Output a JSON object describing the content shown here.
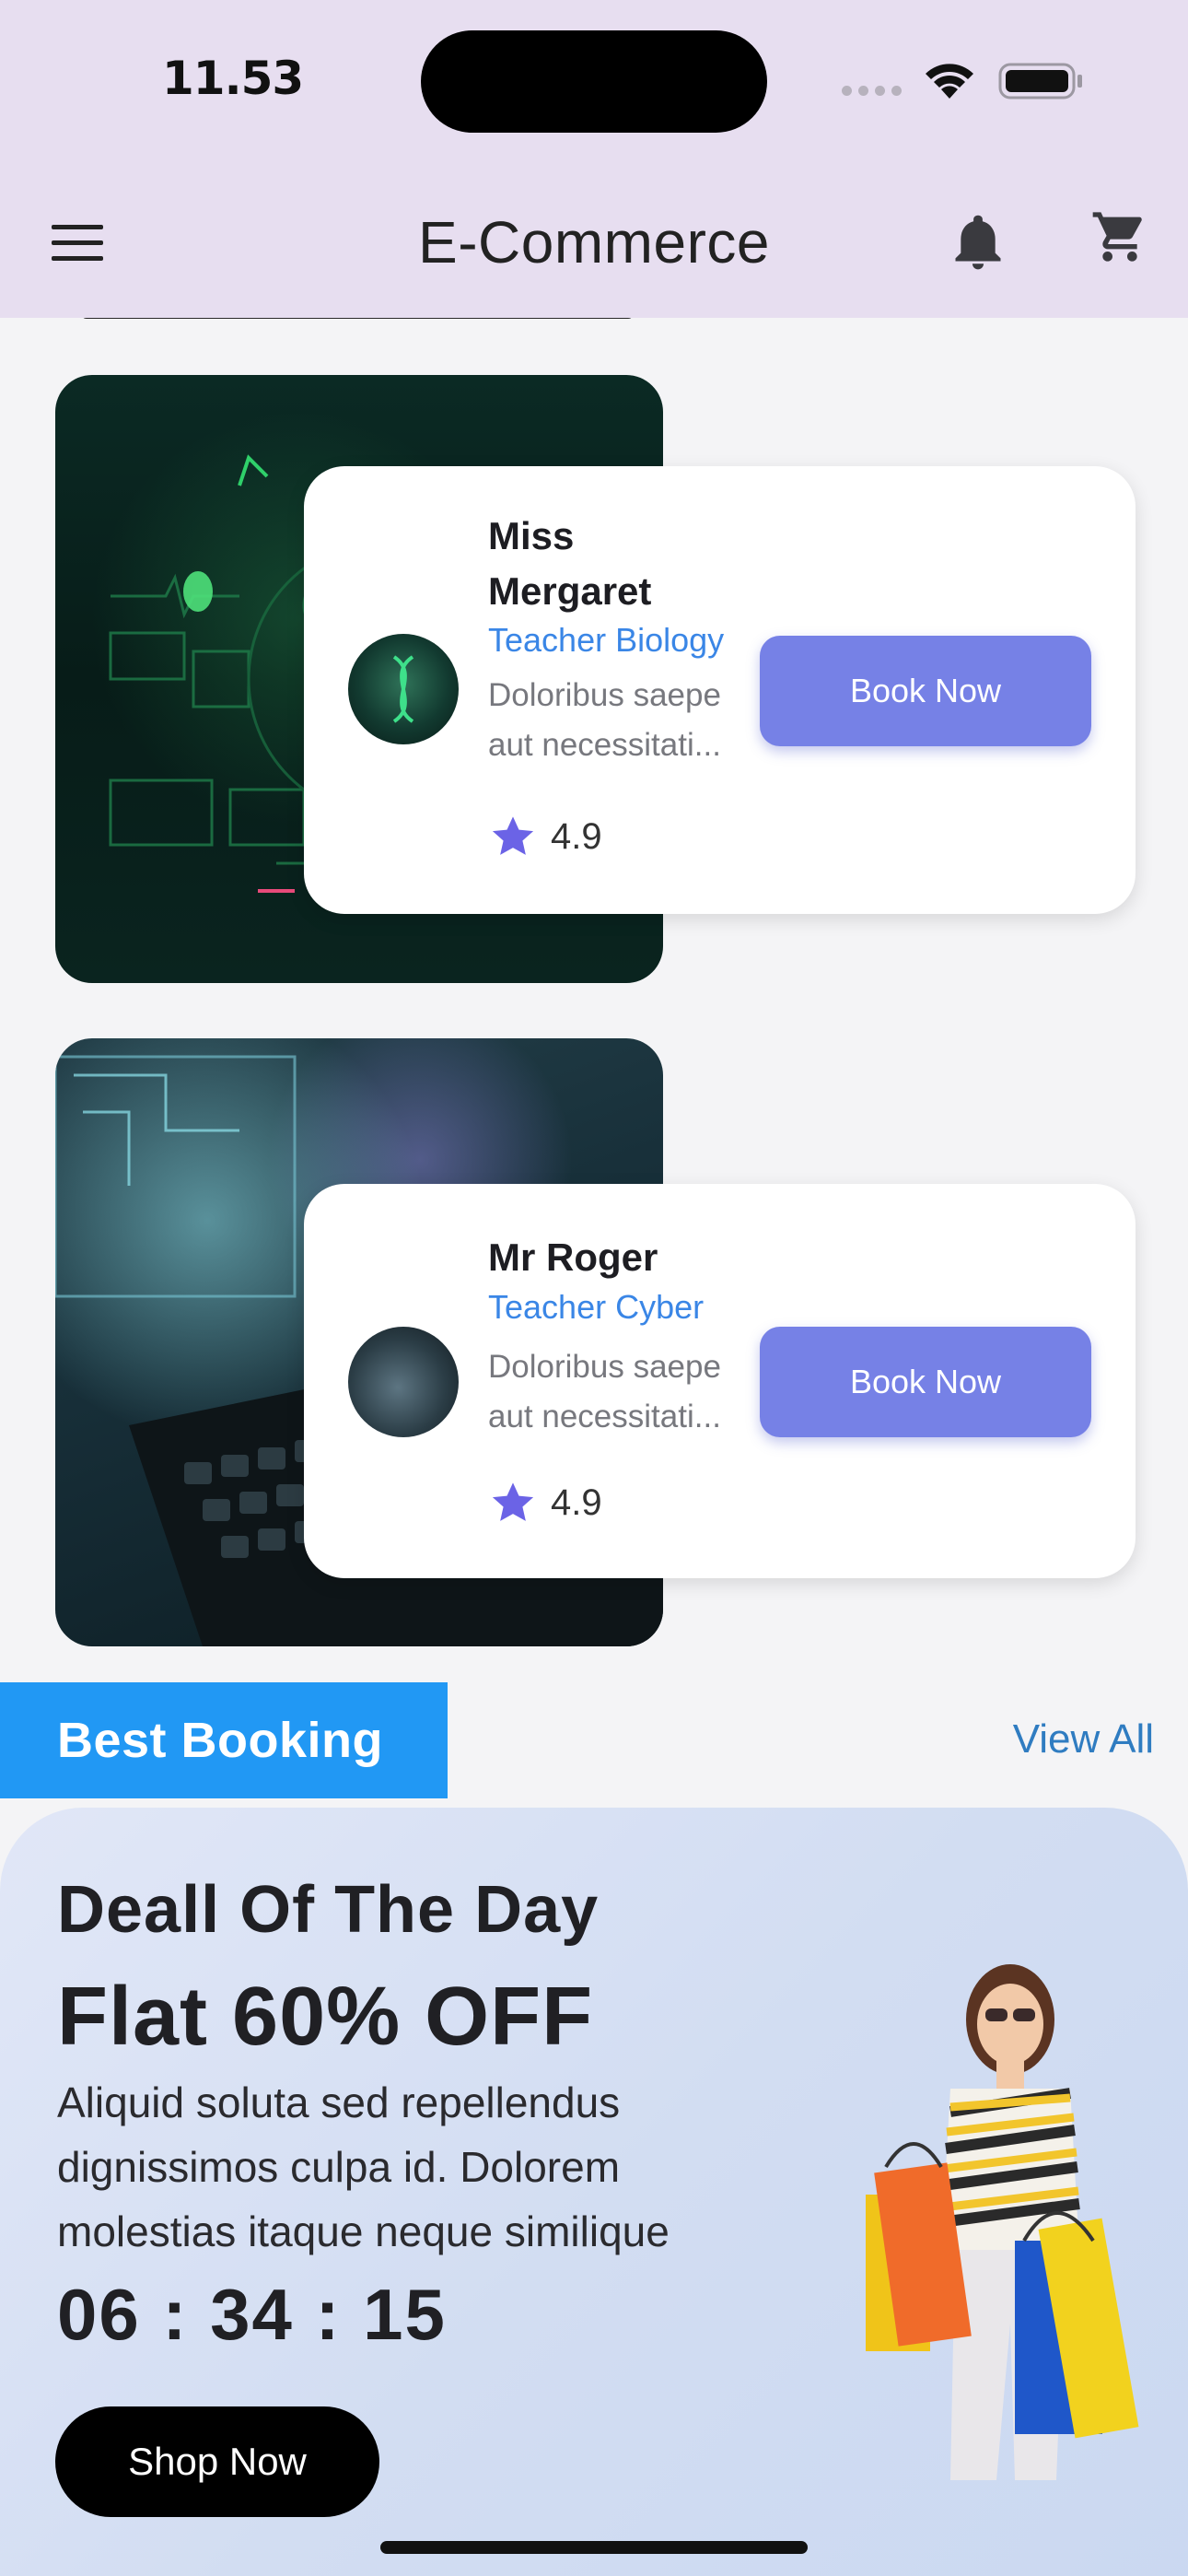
{
  "status_bar": {
    "time": "11.53"
  },
  "app_bar": {
    "title": "E-Commerce"
  },
  "teachers": [
    {
      "name_line1": "Miss",
      "name_line2": "Mergaret",
      "role": "Teacher Biology",
      "desc_line1": "Doloribus saepe",
      "desc_line2": "aut necessitati...",
      "rating": "4.9",
      "button": "Book Now"
    },
    {
      "name_line1": "Mr Roger",
      "role": "Teacher Cyber",
      "desc_line1": "Doloribus saepe",
      "desc_line2": "aut necessitati...",
      "rating": "4.9",
      "button": "Book Now"
    }
  ],
  "best_booking": {
    "title": "Best Booking",
    "view_all": "View All"
  },
  "deal": {
    "title": "Deall Of The Day",
    "discount": "Flat 60% OFF",
    "desc_line1": "Aliquid soluta sed repellendus",
    "desc_line2": "dignissimos culpa id. Dolorem",
    "desc_line3": "molestias itaque neque similique",
    "countdown": "06 : 34 : 15",
    "button": "Shop Now"
  },
  "colors": {
    "appbar_bg": "#e7def0",
    "book_button": "#7681e6",
    "accent_link": "#3a86e6",
    "section_tab": "#2198f4",
    "star": "#6b63e6"
  },
  "icons": [
    "menu-icon",
    "bell-icon",
    "cart-icon",
    "star-icon",
    "wifi-icon",
    "battery-icon"
  ]
}
